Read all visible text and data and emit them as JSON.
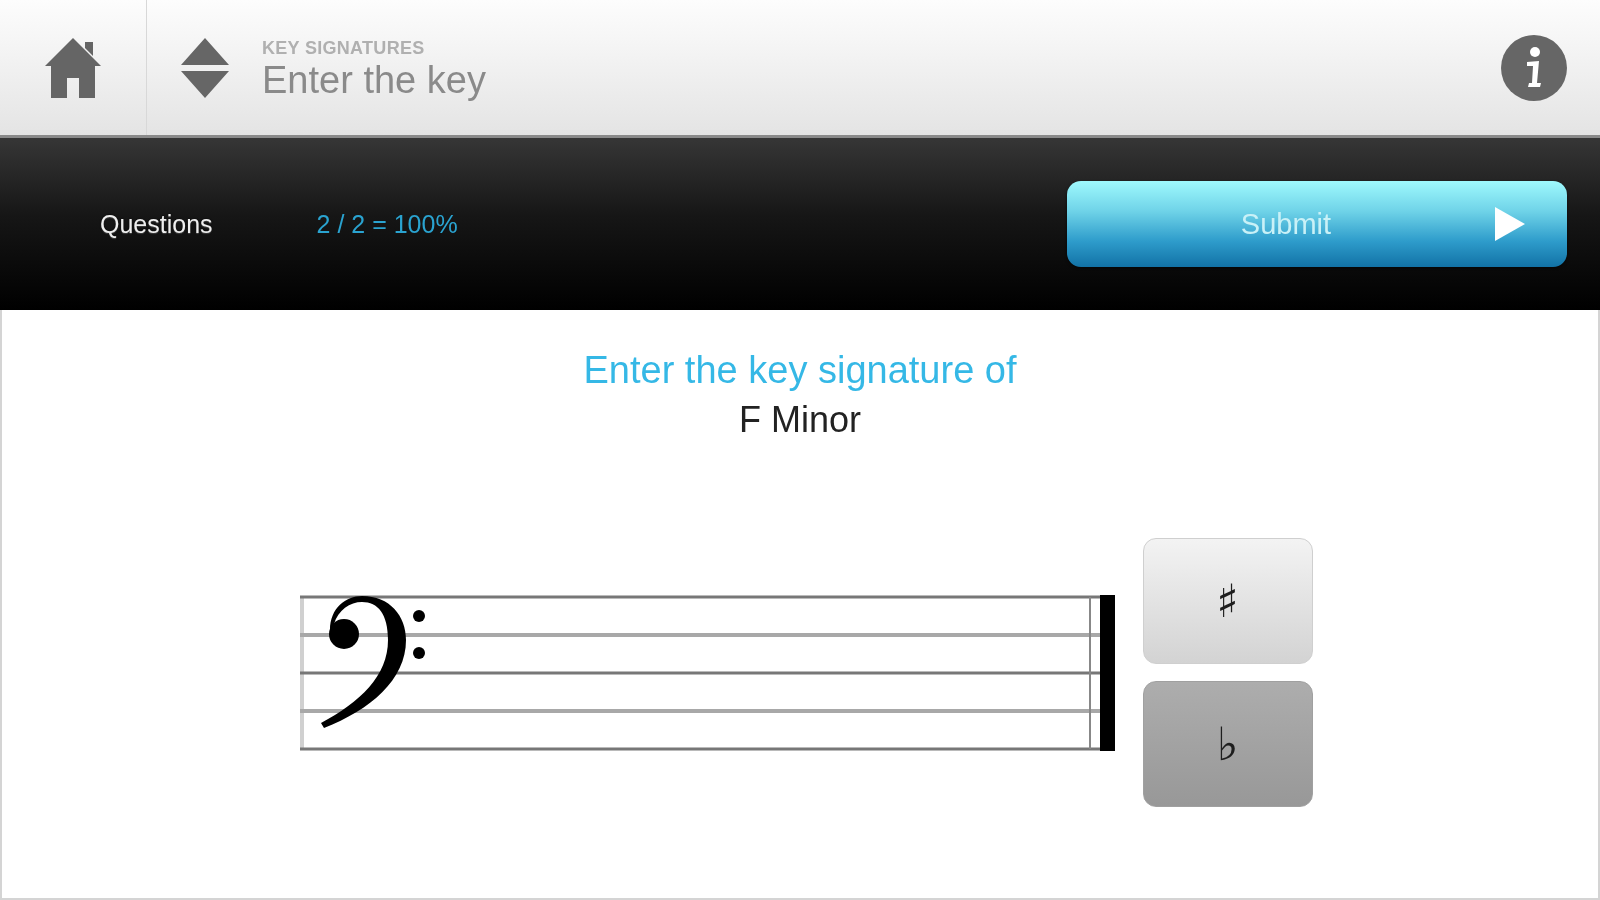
{
  "header": {
    "category": "KEY SIGNATURES",
    "title": "Enter the key"
  },
  "score_bar": {
    "label": "Questions",
    "score": "2 / 2 = 100%",
    "submit": "Submit"
  },
  "question": {
    "prompt": "Enter the key signature of",
    "key": "F Minor"
  },
  "accidentals": [
    {
      "symbol": "♯",
      "selected": false
    },
    {
      "symbol": "♭",
      "selected": true
    }
  ]
}
